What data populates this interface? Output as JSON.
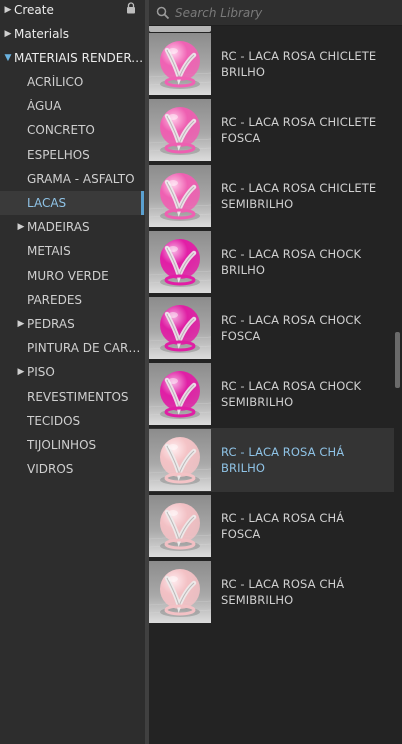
{
  "tree": {
    "top_items": [
      {
        "label": "Create",
        "expanded": false
      },
      {
        "label": "Materials",
        "expanded": false
      },
      {
        "label": "MATERIAIS RENDERC...",
        "expanded": true
      }
    ],
    "children": [
      {
        "label": "ACRÍLICO",
        "has_children": false
      },
      {
        "label": "ÁGUA",
        "has_children": false
      },
      {
        "label": "CONCRETO",
        "has_children": false
      },
      {
        "label": "ESPELHOS",
        "has_children": false
      },
      {
        "label": "GRAMA - ASFALTO",
        "has_children": false
      },
      {
        "label": "LACAS",
        "has_children": false,
        "selected": true
      },
      {
        "label": "MADEIRAS",
        "has_children": true
      },
      {
        "label": "METAIS",
        "has_children": false
      },
      {
        "label": "MURO VERDE",
        "has_children": false
      },
      {
        "label": "PAREDES",
        "has_children": false
      },
      {
        "label": "PEDRAS",
        "has_children": true
      },
      {
        "label": "PINTURA DE CARRO",
        "has_children": false
      },
      {
        "label": "PISO",
        "has_children": true
      },
      {
        "label": "REVESTIMENTOS",
        "has_children": false
      },
      {
        "label": "TECIDOS",
        "has_children": false
      },
      {
        "label": "TIJOLINHOS",
        "has_children": false
      },
      {
        "label": "VIDROS",
        "has_children": false
      }
    ]
  },
  "search": {
    "placeholder": "Search Library",
    "value": ""
  },
  "materials": [
    {
      "name": "RC - LACA ROSA CHICLETE BRILHO",
      "color": "#f062b4",
      "highlight": "#ffd0ec",
      "selected": false
    },
    {
      "name": "RC - LACA ROSA CHICLETE FOSCA",
      "color": "#ee5fb1",
      "highlight": "#ffc6e6",
      "selected": false
    },
    {
      "name": "RC - LACA ROSA CHICLETE SEMIBRILHO",
      "color": "#ef60b2",
      "highlight": "#ffcbe9",
      "selected": false
    },
    {
      "name": "RC - LACA ROSA CHOCK BRILHO",
      "color": "#e21ea6",
      "highlight": "#f8b5e4",
      "selected": false
    },
    {
      "name": "RC - LACA ROSA CHOCK FOSCA",
      "color": "#df1fa4",
      "highlight": "#f3a9dd",
      "selected": false
    },
    {
      "name": "RC - LACA ROSA CHOCK SEMIBRILHO",
      "color": "#e01fa5",
      "highlight": "#f6b0e1",
      "selected": false
    },
    {
      "name": "RC - LACA ROSA CHÁ BRILHO",
      "color": "#f4c3c6",
      "highlight": "#ffeef0",
      "selected": true
    },
    {
      "name": "RC - LACA ROSA CHÁ FOSCA",
      "color": "#f2c0c4",
      "highlight": "#fde7ea",
      "selected": false
    },
    {
      "name": "RC - LACA ROSA CHÁ SEMIBRILHO",
      "color": "#f3c1c5",
      "highlight": "#feebee",
      "selected": false
    }
  ],
  "colors": {
    "accent": "#8fc3e6",
    "panel": "#2d2d2d",
    "library_bg": "#232323"
  }
}
